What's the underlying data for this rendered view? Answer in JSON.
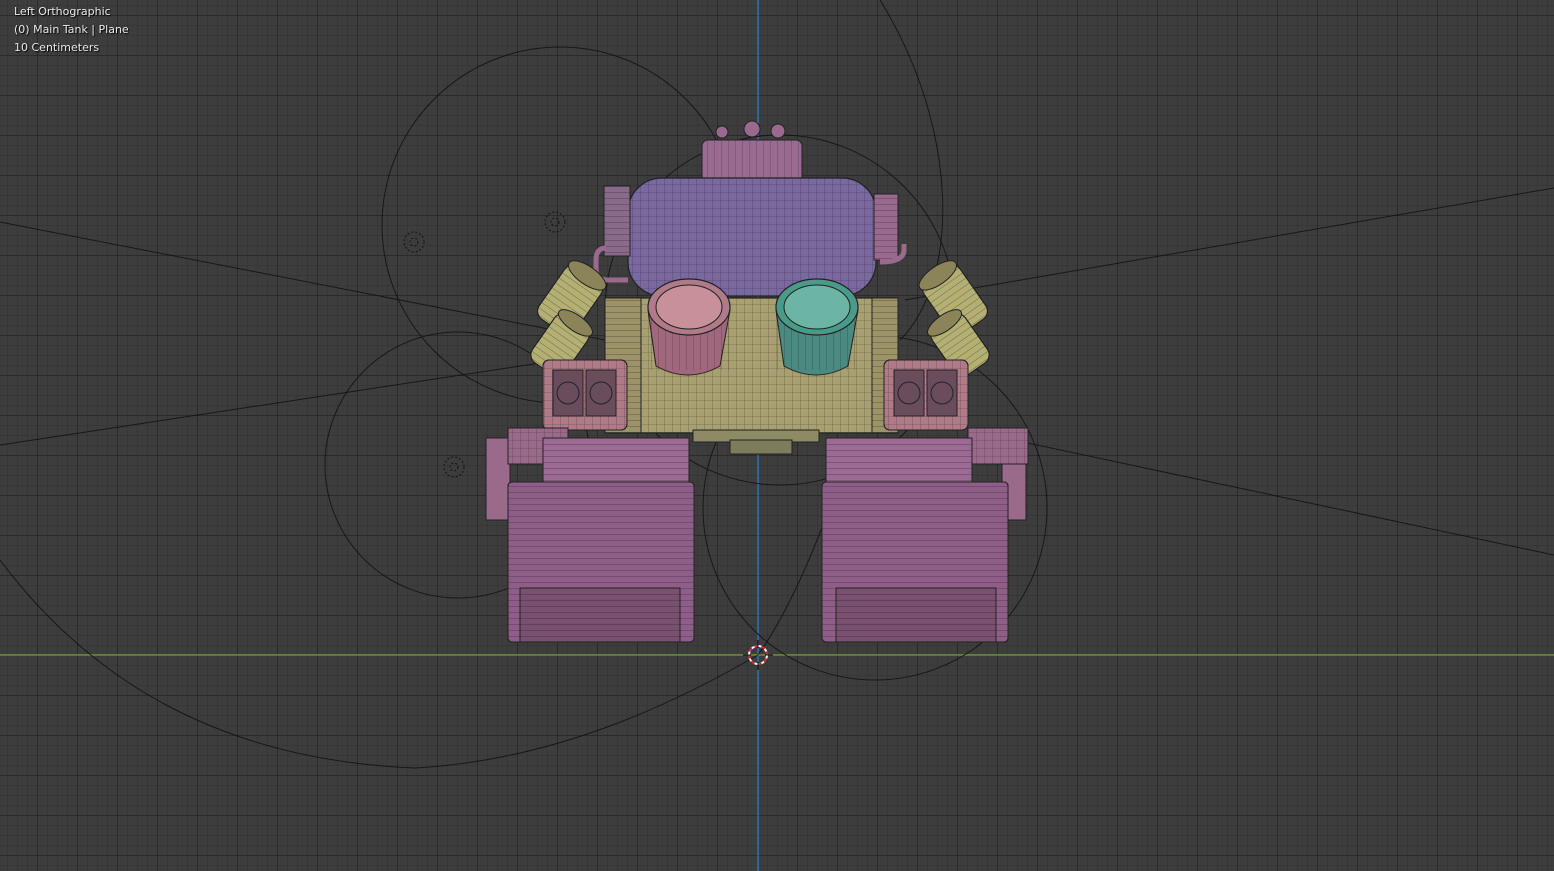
{
  "viewport": {
    "view_name": "Left Orthographic",
    "object_info": "(0) Main Tank | Plane",
    "grid_scale": "10 Centimeters"
  },
  "colors": {
    "background": "#3d3d3d",
    "grid_line": "#2f2f2f",
    "z_axis": "#3b7fd6",
    "y_axis": "#7ea53a",
    "tank_purple": "#7a68a0",
    "pink_mesh": "#a8708f",
    "yellow_mesh": "#a8a070",
    "teal_ring": "#4a9a8a",
    "wire": "#111111"
  },
  "icons": {
    "cursor": "3d-cursor-icon",
    "lamps": "lamp-icon"
  }
}
